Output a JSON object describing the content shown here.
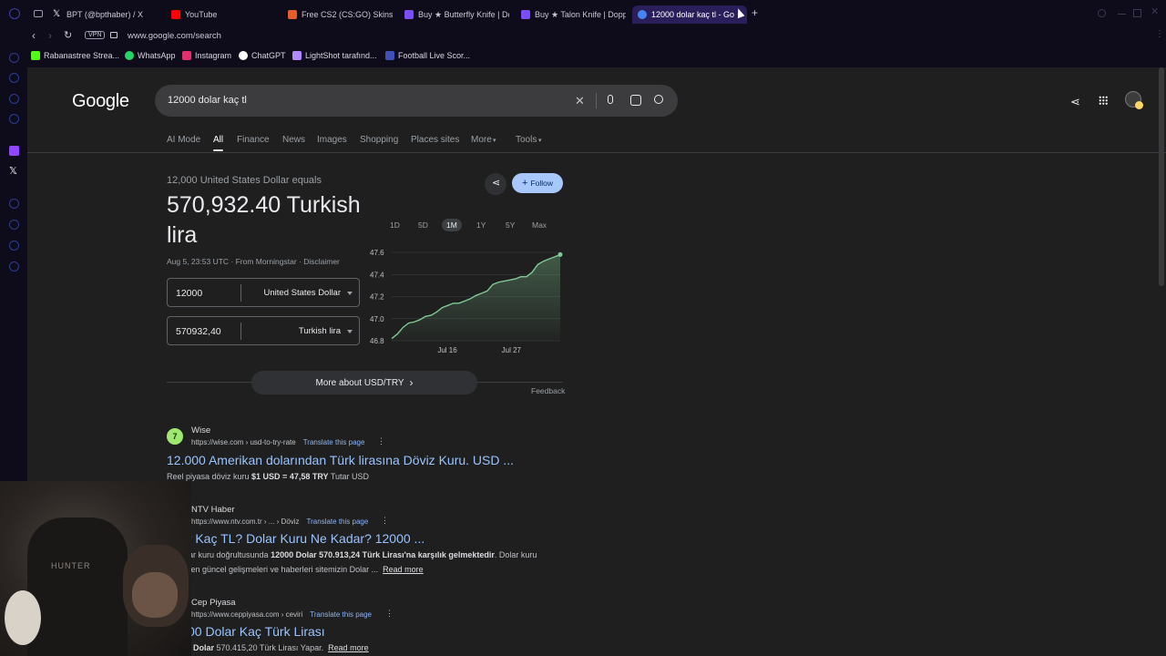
{
  "tabs": [
    {
      "label": "BPT (@bpthaber) / X",
      "color": "#ffffff"
    },
    {
      "label": "YouTube",
      "color": "#ff0000"
    },
    {
      "label": "Free CS2 (CS:GO) Skins |",
      "color": "#e25d2b"
    },
    {
      "label": "Buy ★ Butterfly Knife | Do",
      "color": "#7c4dff"
    },
    {
      "label": "Buy ★ Talon Knife | Doppl",
      "color": "#7c4dff"
    },
    {
      "label": "12000 dolar kaç tl - Go",
      "color": "#4285f4"
    }
  ],
  "address": {
    "vpn": "VPN",
    "url": "www.google.com/search"
  },
  "bookmarks": [
    {
      "label": "Rabanastree Strea...",
      "color": "#53fc18"
    },
    {
      "label": "WhatsApp",
      "color": "#25d366"
    },
    {
      "label": "Instagram",
      "color": "#e1306c"
    },
    {
      "label": "ChatGPT",
      "color": "#ffffff"
    },
    {
      "label": "LightShot tarafınd...",
      "color": "#b388ff"
    },
    {
      "label": "Football Live Scor...",
      "color": "#3f51b5"
    }
  ],
  "google": {
    "logo": "Google",
    "query": "12000 dolar kaç tl",
    "nav": [
      "AI Mode",
      "All",
      "Finance",
      "News",
      "Images",
      "Shopping",
      "Places sites",
      "More",
      "Tools"
    ]
  },
  "converter": {
    "equals": "12,000 United States Dollar equals",
    "result": "570,932.40 Turkish lira",
    "source": "Aug 5, 23:53 UTC · From Morningstar · Disclaimer",
    "from_value": "12000",
    "from_currency": "United States Dollar",
    "to_value": "570932,40",
    "to_currency": "Turkish lira",
    "follow": "Follow",
    "ranges": [
      "1D",
      "5D",
      "1M",
      "1Y",
      "5Y",
      "Max"
    ],
    "more": "More about USD/TRY",
    "feedback": "Feedback"
  },
  "chart_data": {
    "type": "area",
    "series": [
      {
        "values": [
          46.82,
          46.86,
          46.92,
          46.96,
          46.97,
          46.99,
          47.02,
          47.03,
          47.06,
          47.1,
          47.12,
          47.14,
          47.14,
          47.16,
          47.18,
          47.21,
          47.23,
          47.25,
          47.31,
          47.33,
          47.34,
          47.35,
          47.36,
          47.38,
          47.38,
          47.42,
          47.49,
          47.52,
          47.54,
          47.56,
          47.58
        ]
      }
    ],
    "ylim": [
      46.8,
      47.6
    ],
    "yticks": [
      "47.6",
      "47.4",
      "47.2",
      "47.0",
      "46.8"
    ],
    "xticks": [
      "Jul 16",
      "Jul 27"
    ],
    "line_color": "#81c995",
    "grid": true
  },
  "results": [
    {
      "site": "Wise",
      "url": "https://wise.com › usd-to-try-rate",
      "translate": "Translate this page",
      "title": "12.000 Amerikan dolarından Türk lirasına Döviz Kuru. USD ...",
      "snippet_pre": "Reel piyasa döviz kuru ",
      "snippet_bold": "$1 USD = 47,58 TRY",
      "snippet_post": " Tutar USD"
    },
    {
      "site": "NTV Haber",
      "url": "https://www.ntv.com.tr › ... › Döviz",
      "translate": "Translate this page",
      "title": "ar Kaç TL? Dolar Kuru Ne Kadar? 12000 ...",
      "snippet1_pre": "lar kuru doğrultusunda ",
      "snippet1_bold": "12000 Dolar 570.913,24 Türk Lirası'na karşılık gelmektedir",
      "snippet1_post": ". Dolar kuru",
      "snippet2": "i en güncel gelişmeleri ve haberleri sitemizin Dolar ...",
      "read_more": "Read more"
    },
    {
      "site": "Cep Piyasa",
      "url": "https://www.ceppiyasa.com › ceviri",
      "translate": "Translate this page",
      "title": "00 Dolar Kaç Türk Lirası",
      "snippet_bold": "Dolar",
      "snippet_post": " 570.415,20 Türk Lirası Yapar.",
      "read_more": "Read more"
    }
  ],
  "webcam": {
    "shirt_text": "HUNTER"
  }
}
